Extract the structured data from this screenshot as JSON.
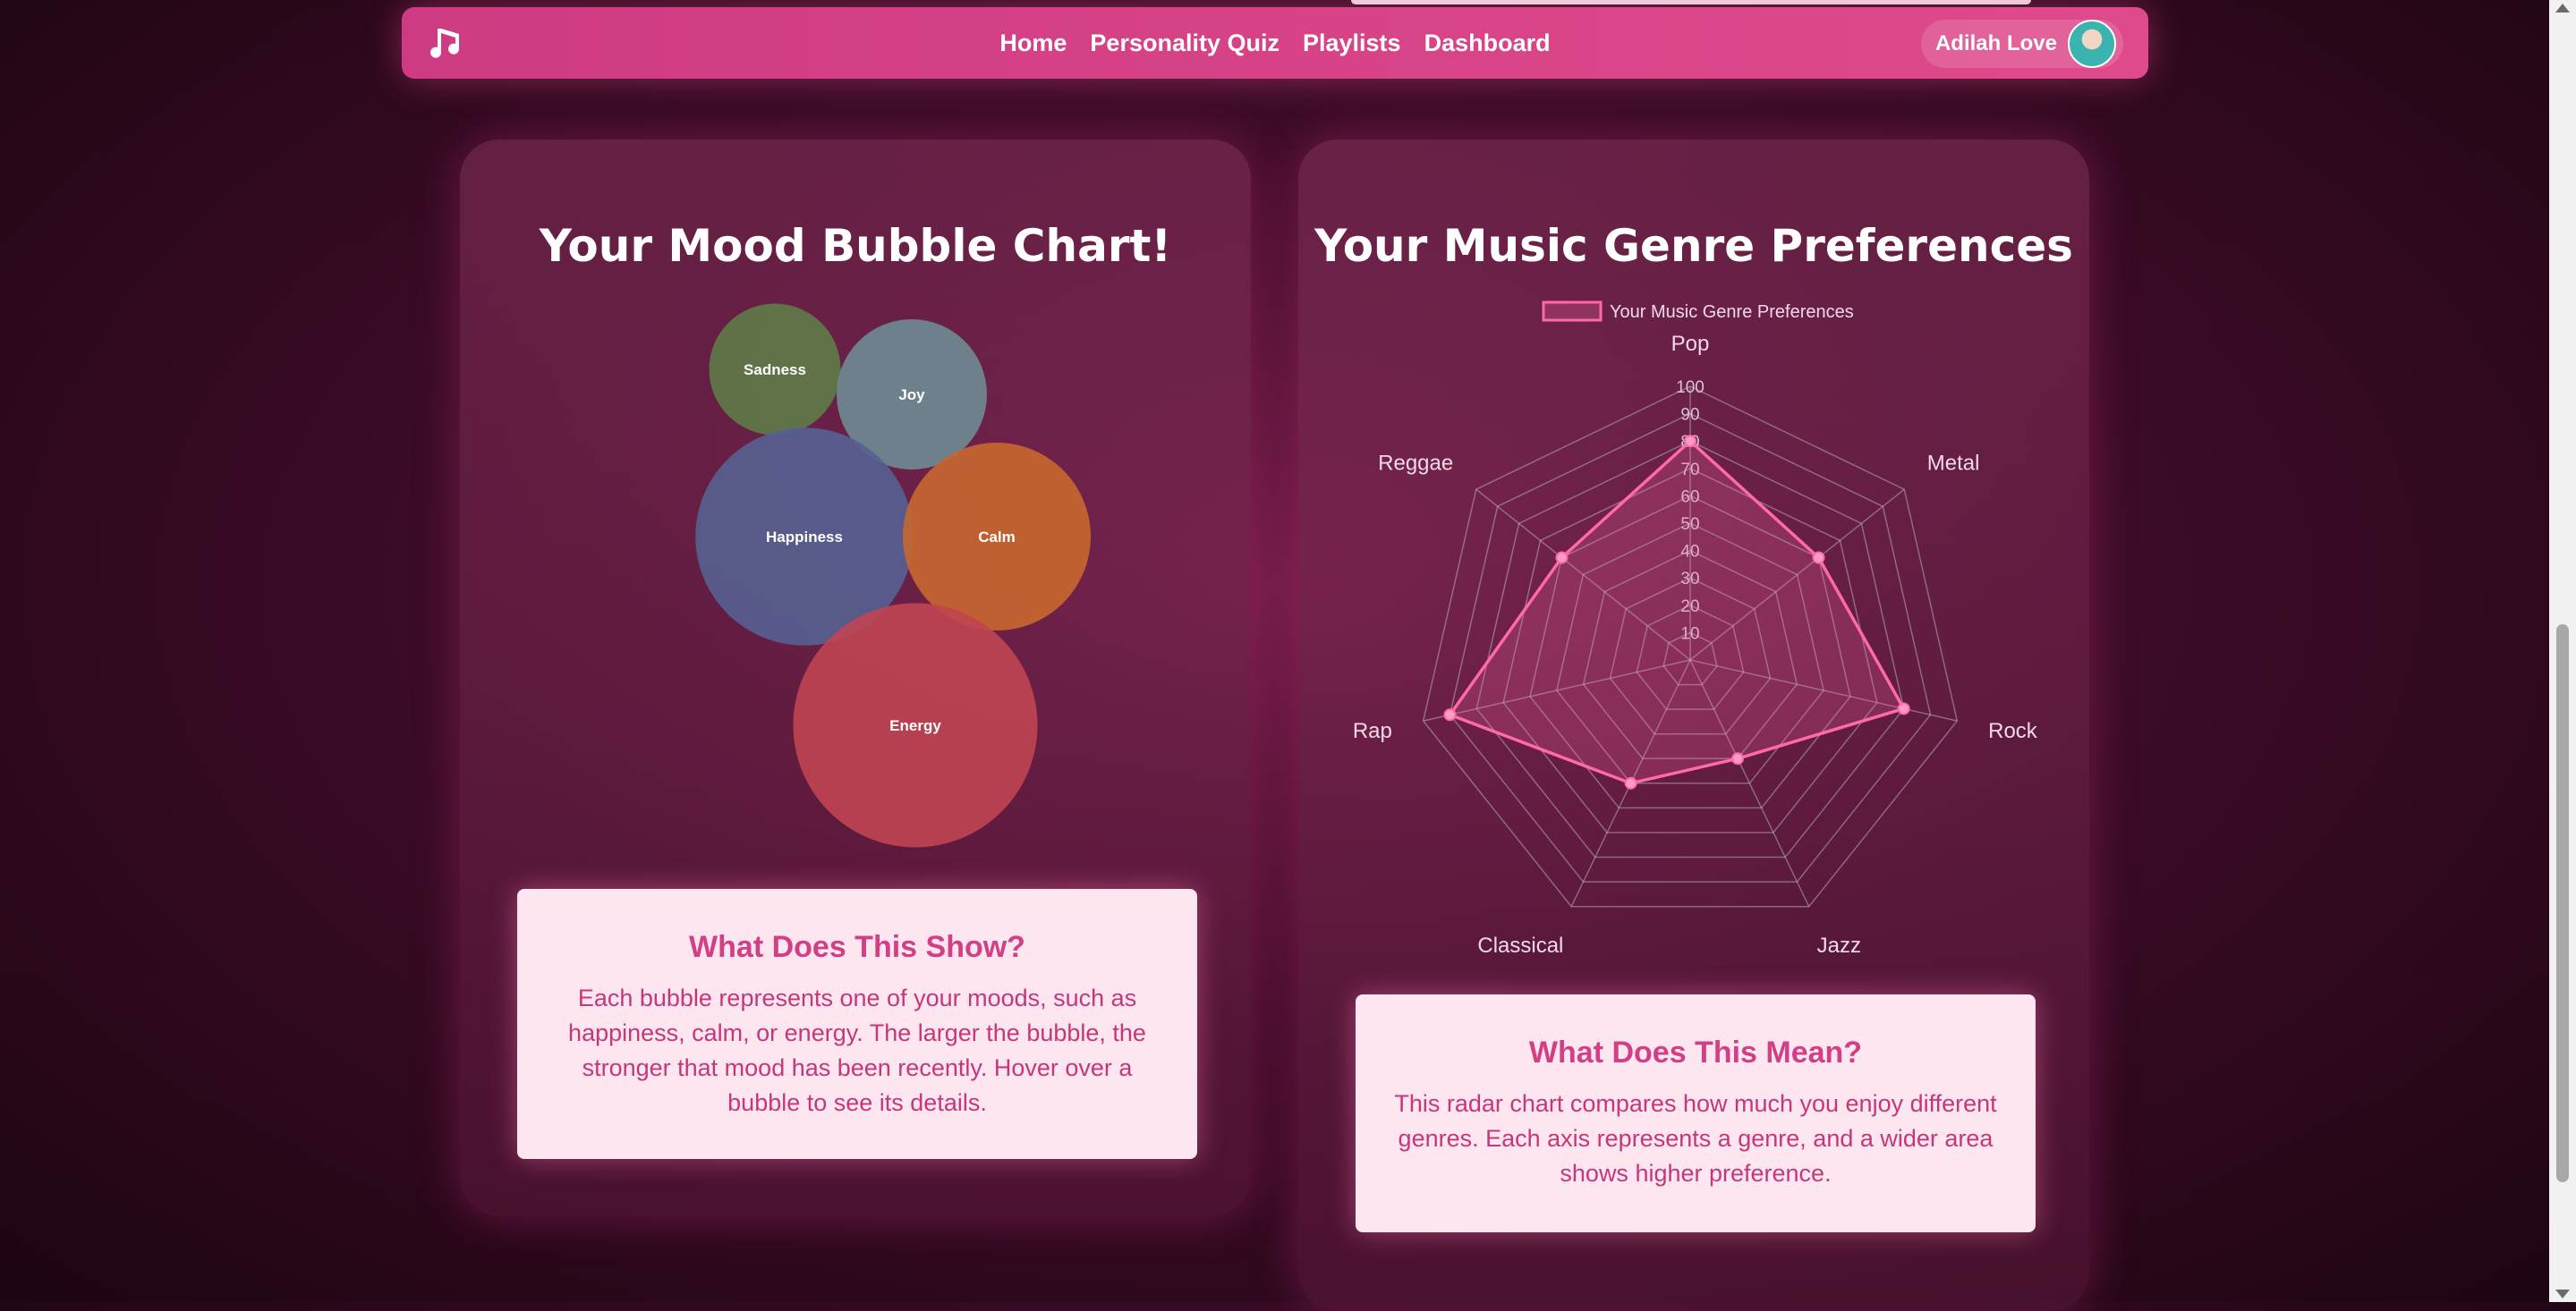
{
  "nav": {
    "logo_icon": "music-note-icon",
    "links": [
      "Home",
      "Personality Quiz",
      "Playlists",
      "Dashboard"
    ],
    "user_name": "Adilah Love"
  },
  "mood_card": {
    "title": "Your Mood Bubble Chart!",
    "info_title": "What Does This Show?",
    "info_body": "Each bubble represents one of your moods, such as happiness, calm, or energy. The larger the bubble, the stronger that mood has been recently. Hover over a bubble to see its details."
  },
  "genre_card": {
    "title": "Your Music Genre Preferences",
    "info_title": "What Does This Mean?",
    "info_body": "This radar chart compares how much you enjoy different genres. Each axis represents a genre, and a wider area shows higher preference."
  },
  "chart_data": [
    {
      "type": "bubble",
      "series": [
        {
          "name": "Sadness",
          "value": 35,
          "color": "#5e7b48"
        },
        {
          "name": "Joy",
          "value": 40,
          "color": "#6e8b92"
        },
        {
          "name": "Happiness",
          "value": 58,
          "color": "#566192"
        },
        {
          "name": "Calm",
          "value": 50,
          "color": "#c8672f"
        },
        {
          "name": "Energy",
          "value": 65,
          "color": "#c04552"
        }
      ]
    },
    {
      "type": "radar",
      "legend": "Your Music Genre Preferences",
      "legend_position": "top",
      "categories": [
        "Pop",
        "Metal",
        "Rock",
        "Jazz",
        "Classical",
        "Rap",
        "Reggae"
      ],
      "values": [
        80,
        60,
        80,
        40,
        50,
        90,
        60
      ],
      "rlim": [
        0,
        100
      ],
      "ticks": [
        10,
        20,
        30,
        40,
        50,
        60,
        70,
        80,
        90,
        100
      ],
      "line_color": "#ff6aa6"
    }
  ]
}
